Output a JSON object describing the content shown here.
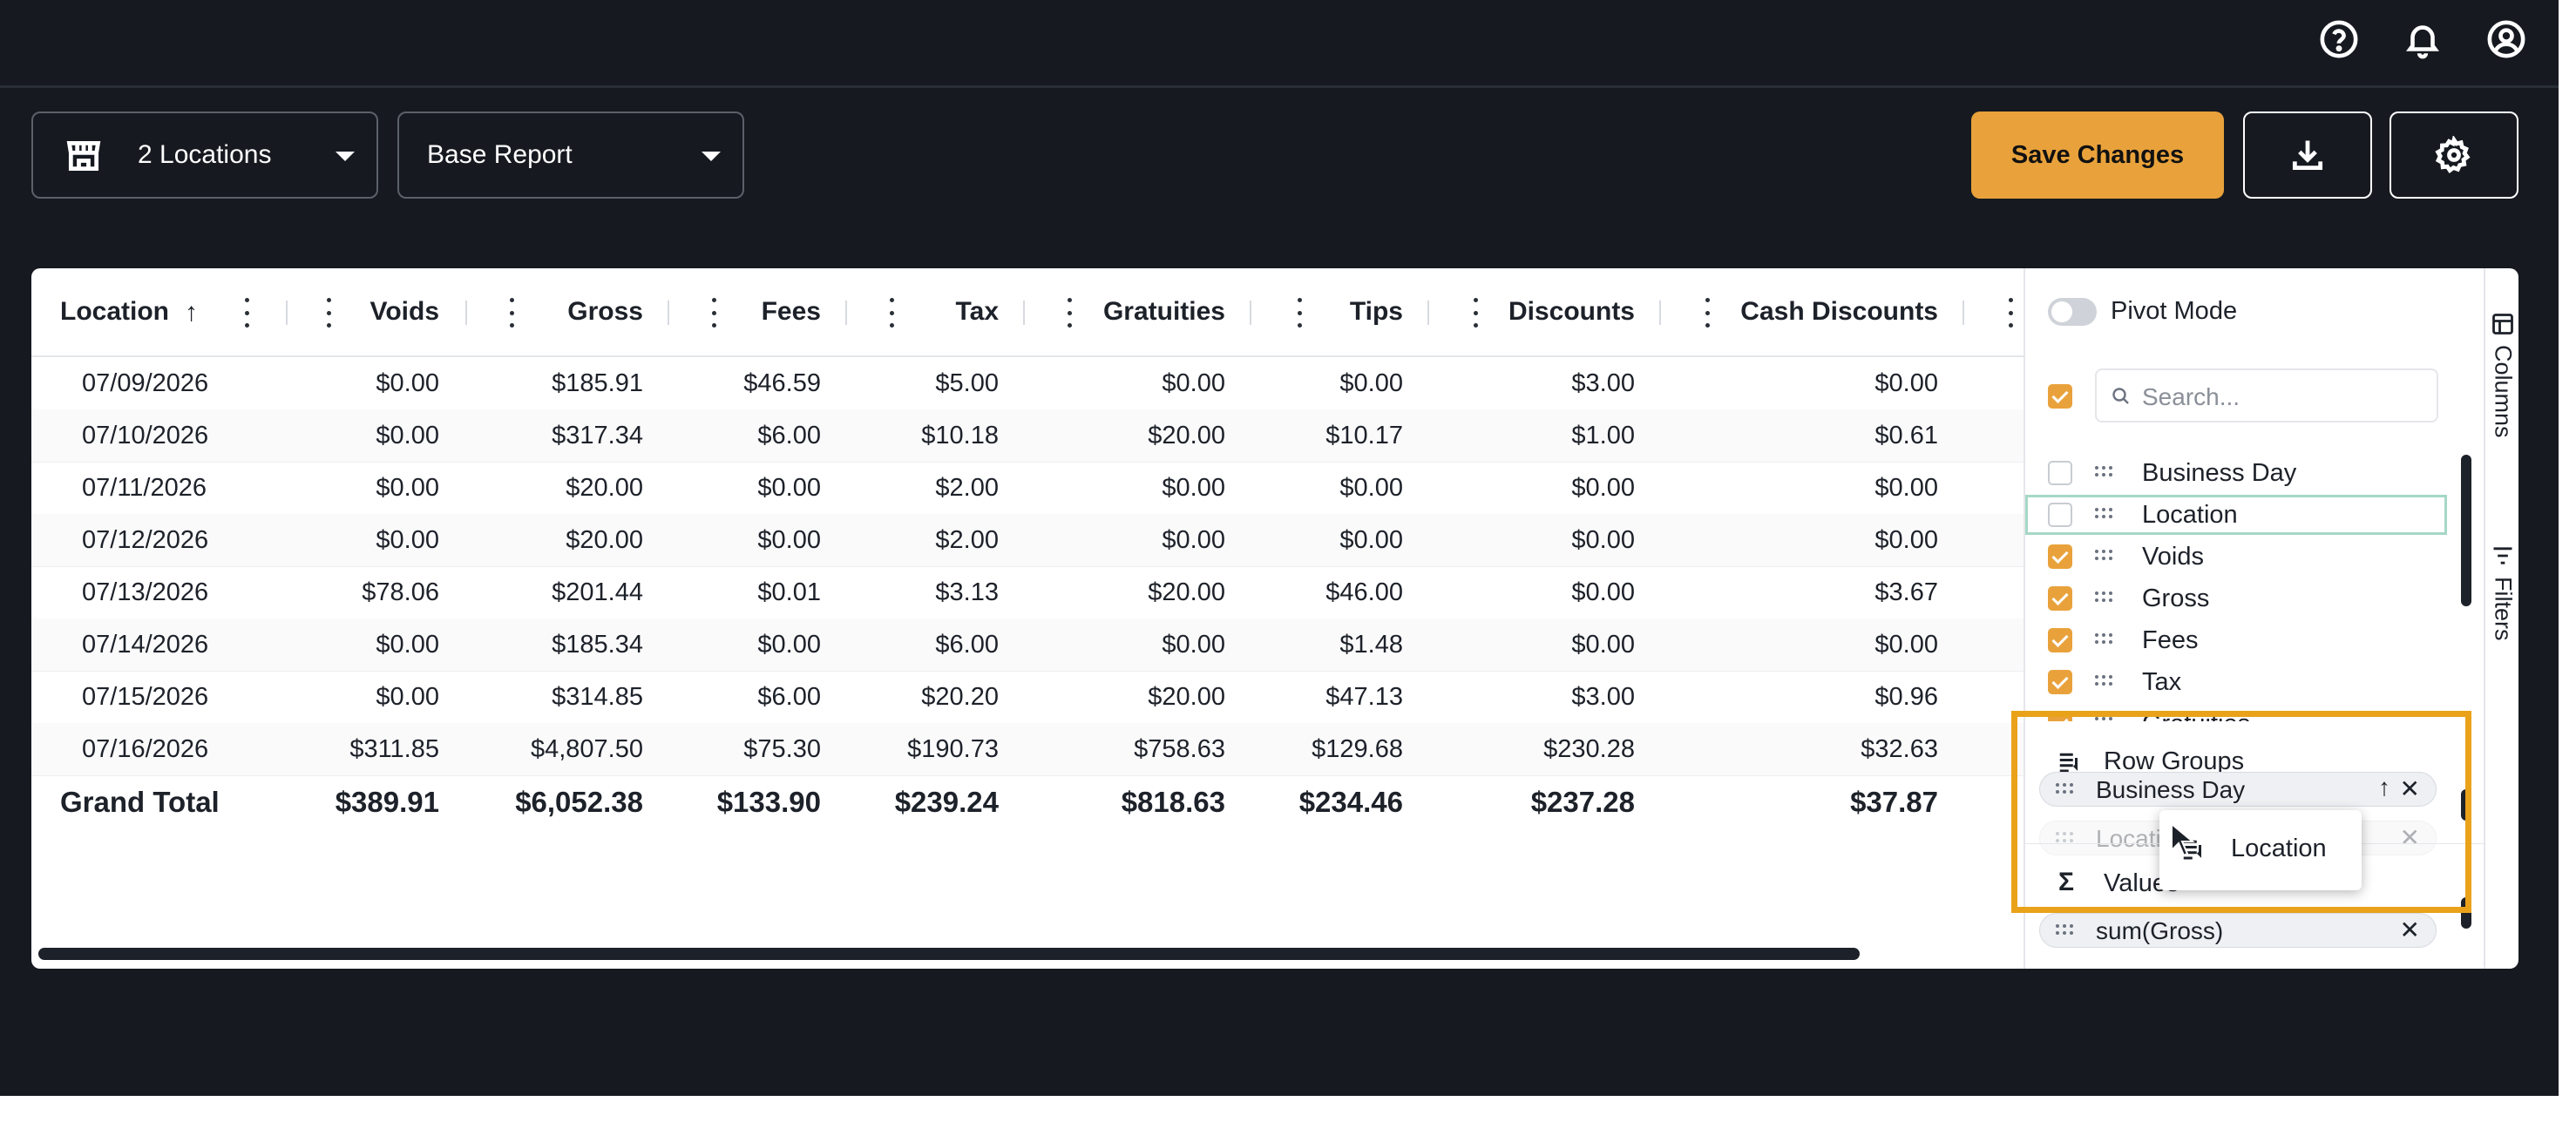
{
  "topbar": {
    "icons": [
      "help-circle-icon",
      "bell-icon",
      "user-circle-icon"
    ]
  },
  "toolbar": {
    "locations_label": "2 Locations",
    "report_label": "Base Report",
    "save_label": "Save Changes",
    "accent_color": "#e9a23b"
  },
  "grid": {
    "columns": [
      "Location",
      "Voids",
      "Gross",
      "Fees",
      "Tax",
      "Gratuities",
      "Tips",
      "Discounts",
      "Cash Discounts"
    ],
    "rows": [
      [
        "07/09/2026",
        "$0.00",
        "$185.91",
        "$46.59",
        "$5.00",
        "$0.00",
        "$0.00",
        "$3.00",
        "$0.00"
      ],
      [
        "07/10/2026",
        "$0.00",
        "$317.34",
        "$6.00",
        "$10.18",
        "$20.00",
        "$10.17",
        "$1.00",
        "$0.61"
      ],
      [
        "07/11/2026",
        "$0.00",
        "$20.00",
        "$0.00",
        "$2.00",
        "$0.00",
        "$0.00",
        "$0.00",
        "$0.00"
      ],
      [
        "07/12/2026",
        "$0.00",
        "$20.00",
        "$0.00",
        "$2.00",
        "$0.00",
        "$0.00",
        "$0.00",
        "$0.00"
      ],
      [
        "07/13/2026",
        "$78.06",
        "$201.44",
        "$0.01",
        "$3.13",
        "$20.00",
        "$46.00",
        "$0.00",
        "$3.67"
      ],
      [
        "07/14/2026",
        "$0.00",
        "$185.34",
        "$0.00",
        "$6.00",
        "$0.00",
        "$1.48",
        "$0.00",
        "$0.00"
      ],
      [
        "07/15/2026",
        "$0.00",
        "$314.85",
        "$6.00",
        "$20.20",
        "$20.00",
        "$47.13",
        "$3.00",
        "$0.96"
      ],
      [
        "07/16/2026",
        "$311.85",
        "$4,807.50",
        "$75.30",
        "$190.73",
        "$758.63",
        "$129.68",
        "$230.28",
        "$32.63"
      ]
    ],
    "total": [
      "Grand Total",
      "$389.91",
      "$6,052.38",
      "$133.90",
      "$239.24",
      "$818.63",
      "$234.46",
      "$237.28",
      "$37.87"
    ]
  },
  "side_panel": {
    "pivot_label": "Pivot Mode",
    "search_placeholder": "Search...",
    "columns": [
      {
        "label": "Business Day",
        "checked": false
      },
      {
        "label": "Location",
        "checked": false
      },
      {
        "label": "Voids",
        "checked": true
      },
      {
        "label": "Gross",
        "checked": true
      },
      {
        "label": "Fees",
        "checked": true
      },
      {
        "label": "Tax",
        "checked": true
      },
      {
        "label": "Gratuities",
        "checked": true
      }
    ],
    "row_groups_title": "Row Groups",
    "row_groups": [
      "Business Day",
      "Location"
    ],
    "values_title": "Values",
    "values": [
      "sum(Gross)"
    ],
    "drag_label": "Location",
    "tabs": [
      "Columns",
      "Filters"
    ]
  }
}
